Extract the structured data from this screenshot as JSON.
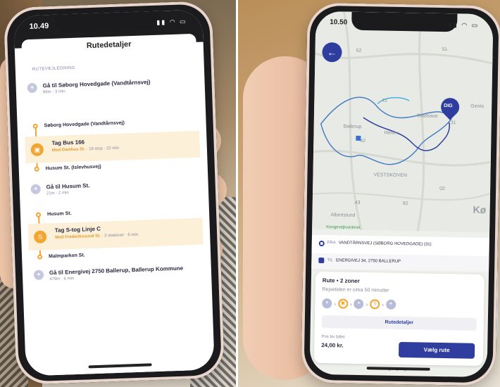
{
  "left_phone": {
    "time": "10.49",
    "title": "Rutedetaljer",
    "section": "RUTEVEJLEDNING",
    "steps": [
      {
        "title": "Gå til Søborg Hovedgade (Vandtårnsvej)",
        "sub": "86m · 3 min"
      },
      {
        "title": "Gå til Husum St.",
        "sub": "21m · 2 min"
      },
      {
        "title": "Gå til Energivej 2750 Ballerup, Ballerup Kommune",
        "sub": "479m · 6 min"
      }
    ],
    "stops": {
      "s1": "Søborg Hovedgade (Vandtårnsvej)",
      "s2": "Husum St. (Islevhusvej)",
      "s3": "Husum St.",
      "s4": "Malmparken St."
    },
    "transit1": {
      "title": "Tag Bus 166",
      "dir": "Mod Damhus St.",
      "detail": " · 19 stop · 22 min"
    },
    "transit2": {
      "title": "Tag S-tog Linje C",
      "dir": "Mod Frederikssund St.",
      "detail": " · 3 stationer · 6 min"
    }
  },
  "right_phone": {
    "time": "10.50",
    "marker": "DIG",
    "map_labels": {
      "gladsaxe": "Gladsaxe",
      "herlev": "Herlev",
      "ballerup": "Ballerup",
      "gentofte": "Gento",
      "vestskoven": "VESTSKOVEN",
      "kobenhavn": "Kø",
      "albertslund": "Albertslund",
      "road_52": "52",
      "road_51": "51",
      "road_41": "41",
      "road_42": "42",
      "road_31": "31",
      "road_02": "02",
      "road_43": "43",
      "road_92": "92"
    },
    "green_legend": "Kongevejkvarteret",
    "from_label": "FRA",
    "from_value": "VANDTÅRNSVEJ (SØBORG HOVEDGADE) (31)",
    "to_label": "TIL",
    "to_value": "ENERGIVEJ 34, 2750 BALLERUP",
    "card_title": "Rute • 2 zoner",
    "card_sub": "Rejsetiden er cirka 50 minutter",
    "details_button": "Rutedetaljer",
    "price_label": "Pris for billet",
    "price": "24,00 kr.",
    "choose_button": "Vælg rute",
    "pager": "• • •"
  }
}
